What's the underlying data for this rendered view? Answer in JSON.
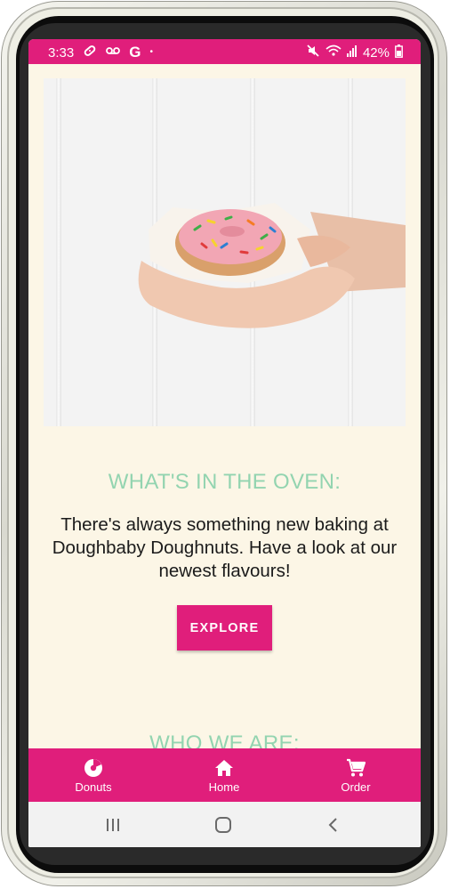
{
  "status_bar": {
    "time": "3:33",
    "left_icons": [
      "bandage-icon",
      "voicemail-icon",
      "google-icon",
      "dot-icon"
    ],
    "battery": "42%",
    "right_icons": [
      "mute-icon",
      "wifi-icon",
      "signal-icon",
      "battery-icon"
    ]
  },
  "hero": {
    "image_subject": "hands holding a pink frosted donut with sprinkles"
  },
  "section1": {
    "title": "WHAT'S IN THE OVEN:",
    "body": "There's always something new baking at Doughbaby Doughnuts. Have a look at our newest flavours!",
    "button_label": "EXPLORE"
  },
  "section2": {
    "title": "WHO WE ARE:"
  },
  "bottom_nav": {
    "items": [
      {
        "label": "Donuts",
        "icon": "donut-icon"
      },
      {
        "label": "Home",
        "icon": "home-icon"
      },
      {
        "label": "Order",
        "icon": "cart-icon"
      }
    ]
  },
  "colors": {
    "brand_pink": "#e01e7b",
    "background": "#fcf6e6",
    "title_mint": "#93d4b0",
    "text": "#1b1b1b"
  }
}
